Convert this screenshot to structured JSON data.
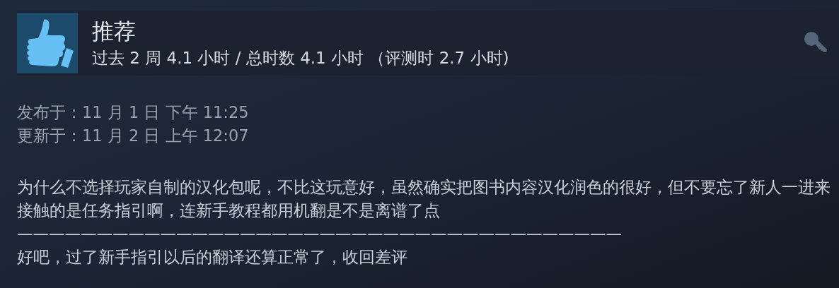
{
  "header": {
    "verdict": "推荐",
    "kind": "recommended",
    "hours": "过去 2 周 4.1 小时 / 总时数 4.1 小时 （评测时 2.7 小时)"
  },
  "dates": [
    "发布于：11 月 1 日 下午 11:25",
    "更新于：11 月 2 日 上午 12:07"
  ],
  "paragraphs": [
    "为什么不选择玩家自制的汉化包呢，不比这玩意好，虽然确实把图书内容汉化润色的很好，但不要忘了新人一进来接触的是任务指引啊，连新手教程都用机翻是不是离谱了点",
    "——————————————————————————————————————",
    "好吧，过了新手指引以后的翻译还算正常了，收回差评"
  ]
}
